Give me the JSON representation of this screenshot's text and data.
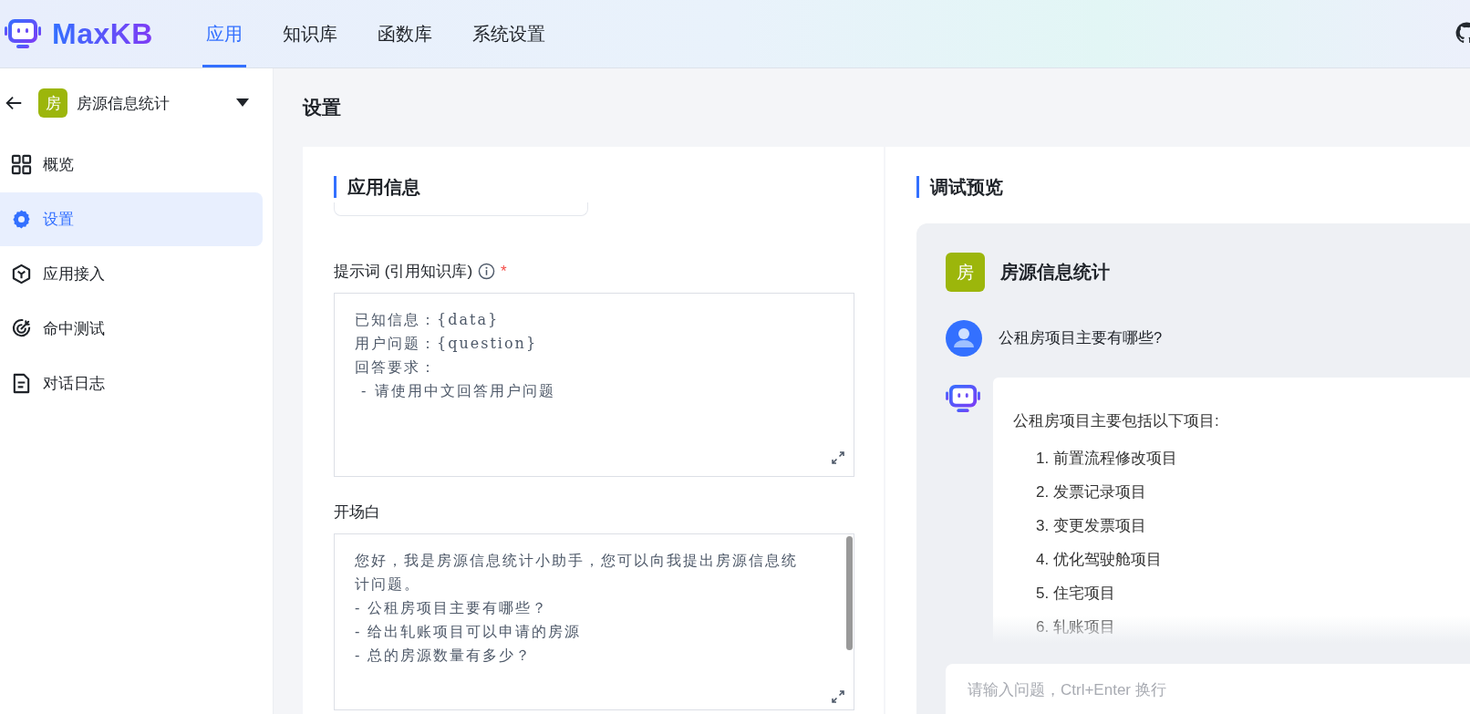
{
  "header": {
    "logo": "MaxKB",
    "nav": [
      {
        "label": "应用",
        "selected": true
      },
      {
        "label": "知识库",
        "selected": false
      },
      {
        "label": "函数库",
        "selected": false
      },
      {
        "label": "系统设置",
        "selected": false
      }
    ]
  },
  "sidebar": {
    "app": {
      "avatar": "房",
      "name": "房源信息统计"
    },
    "items": [
      {
        "label": "概览",
        "selected": false
      },
      {
        "label": "设置",
        "selected": true
      },
      {
        "label": "应用接入",
        "selected": false
      },
      {
        "label": "命中测试",
        "selected": false
      },
      {
        "label": "对话日志",
        "selected": false
      }
    ]
  },
  "page_title": "设置",
  "app_info": {
    "heading": "应用信息",
    "prompt": {
      "label": "提示词 (引用知识库)",
      "required_mark": "*",
      "value": "已知信息：{data}\n用户问题：{question}\n回答要求：\n - 请使用中文回答用户问题"
    },
    "opening": {
      "label": "开场白",
      "value": "您好，我是房源信息统计小助手，您可以向我提出房源信息统计问题。\n- 公租房项目主要有哪些？\n- 给出轧账项目可以申请的房源\n- 总的房源数量有多少？"
    }
  },
  "preview": {
    "heading": "调试预览",
    "app_avatar": "房",
    "app_name": "房源信息统计",
    "question": "公租房项目主要有哪些?",
    "answer": {
      "intro": "公租房项目主要包括以下项目:",
      "items": [
        "1. 前置流程修改项目",
        "2. 发票记录项目",
        "3. 变更发票项目",
        "4. 优化驾驶舱项目",
        "5. 住宅项目",
        "6. 轧账项目"
      ]
    },
    "input": {
      "placeholder": "请输入问题，Ctrl+Enter 换行"
    }
  }
}
